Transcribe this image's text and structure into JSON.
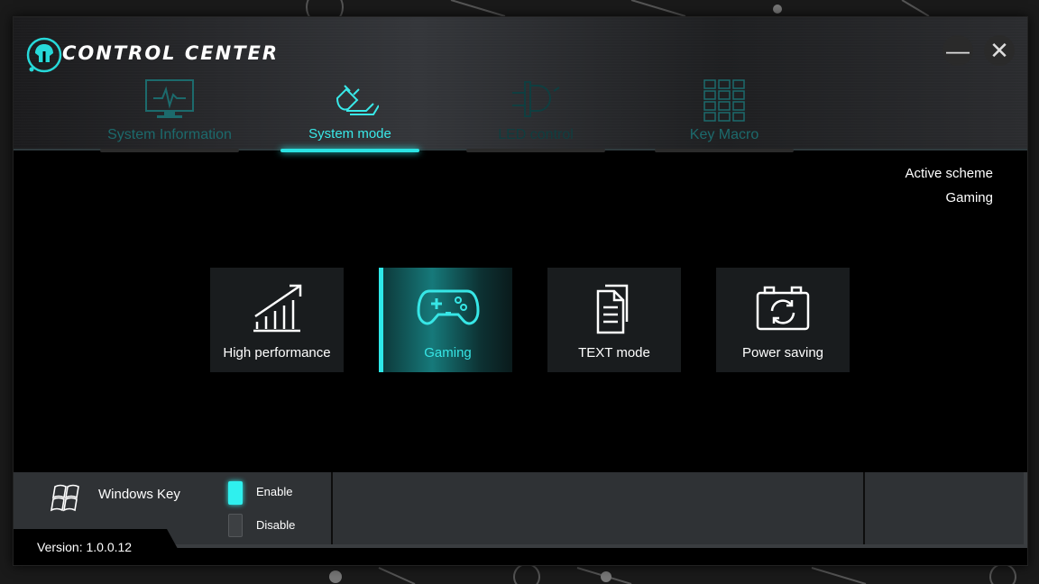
{
  "app": {
    "title": "CONTROL CENTER"
  },
  "window_controls": {
    "minimize": "—",
    "close": "✕"
  },
  "tabs": [
    {
      "label": "System Information",
      "icon": "monitor-icon",
      "state": "inactive"
    },
    {
      "label": "System mode",
      "icon": "power-plug-icon",
      "state": "active"
    },
    {
      "label": "LED control",
      "icon": "led-bulb-icon",
      "state": "inactive"
    },
    {
      "label": "Key Macro",
      "icon": "keypad-icon",
      "state": "inactive"
    }
  ],
  "scheme": {
    "title": "Active scheme",
    "value": "Gaming"
  },
  "modes": [
    {
      "label": "High performance",
      "icon": "chart-up-icon",
      "selected": false
    },
    {
      "label": "Gaming",
      "icon": "gamepad-icon",
      "selected": true
    },
    {
      "label": "TEXT mode",
      "icon": "document-icon",
      "selected": false
    },
    {
      "label": "Power saving",
      "icon": "battery-cycle-icon",
      "selected": false
    }
  ],
  "windows_key": {
    "label": "Windows Key",
    "enable_label": "Enable",
    "disable_label": "Disable",
    "state": "Enable"
  },
  "version": "Version: 1.0.0.12",
  "colors": {
    "accent": "#2ee8e8",
    "background": "#000000",
    "panel": "#191c1e"
  }
}
